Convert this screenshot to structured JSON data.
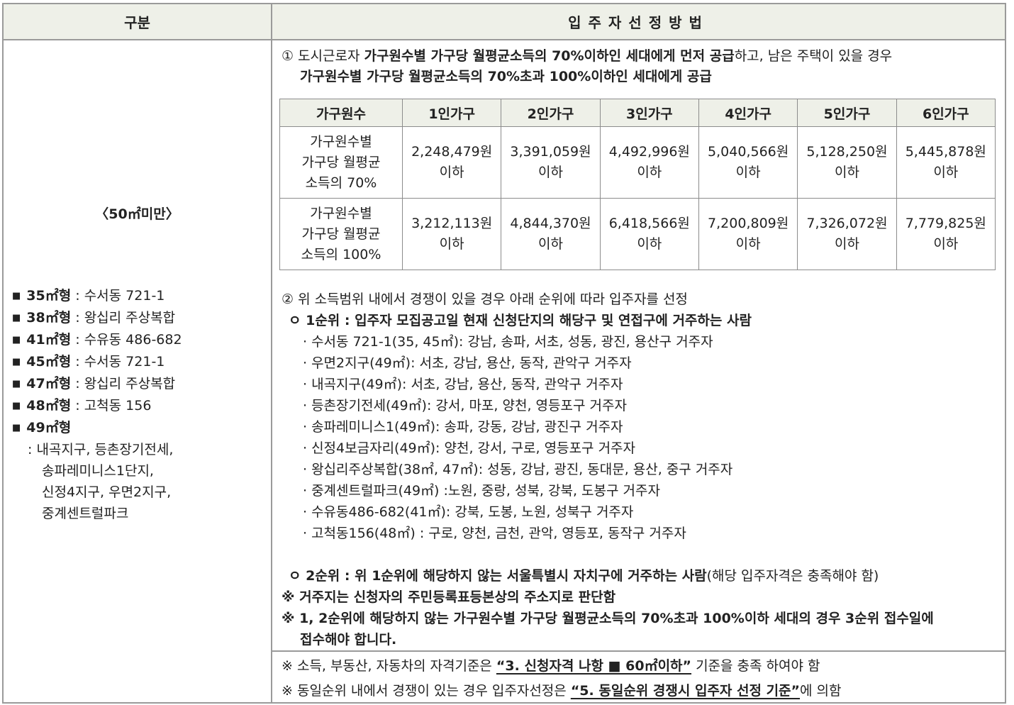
{
  "header": {
    "left": "구분",
    "right": "입주자선정방법"
  },
  "left": {
    "size_title": "〈50㎡미만〉",
    "sizes": [
      {
        "label": "35㎡형",
        "sep": " : ",
        "place": "수서동 721-1"
      },
      {
        "label": "38㎡형",
        "sep": " : ",
        "place": "왕십리 주상복합"
      },
      {
        "label": "41㎡형",
        "sep": " : ",
        "place": "수유동 486-682"
      },
      {
        "label": "45㎡형",
        "sep": " : ",
        "place": "수서동 721-1"
      },
      {
        "label": "47㎡형",
        "sep": " : ",
        "place": "왕십리 주상복합"
      },
      {
        "label": "48㎡형",
        "sep": " : ",
        "place": "고척동 156"
      }
    ],
    "last_label": "49㎡형",
    "last_lines": [
      ": 내곡지구, 등촌장기전세,",
      "송파레미니스1단지,",
      "신정4지구, 우면2지구,",
      "중계센트럴파크"
    ]
  },
  "lead": {
    "line1_a": "① 도시근로자 ",
    "line1_b": "가구원수별 가구당 월평균소득의 70%이하인 세대에게 먼저 공급",
    "line1_c": "하고, 남은 주택이 있을 경우",
    "line2": "가구원수별 가구당 월평균소득의 70%초과 100%이하인 세대에게 공급"
  },
  "income_table": {
    "headers": [
      "가구원수",
      "1인가구",
      "2인가구",
      "3인가구",
      "4인가구",
      "5인가구",
      "6인가구"
    ],
    "rows": [
      {
        "head": [
          "가구원수별",
          "가구당 월평균",
          "소득의 70%"
        ],
        "values": [
          "2,248,479원",
          "3,391,059원",
          "4,492,996원",
          "5,040,566원",
          "5,128,250원",
          "5,445,878원"
        ]
      },
      {
        "head": [
          "가구원수별",
          "가구당 월평균",
          "소득의 100%"
        ],
        "values": [
          "3,212,113원",
          "4,844,370원",
          "6,418,566원",
          "7,200,809원",
          "7,326,072원",
          "7,779,825원"
        ]
      }
    ],
    "suffix": "이하"
  },
  "section2": {
    "title": "② 위 소득범위 내에서 경쟁이 있을 경우 아래 순위에 따라 입주자를 선정",
    "rank1": "ㅇ 1순위 : 입주자 모집공고일 현재 신청단지의 해당구 및 연접구에 거주하는 사람",
    "items": [
      "· 수서동 721-1(35, 45㎡): 강남, 송파, 서초, 성동, 광진, 용산구 거주자",
      "· 우면2지구(49㎡): 서초, 강남, 용산, 동작, 관악구 거주자",
      "· 내곡지구(49㎡): 서초, 강남, 용산, 동작, 관악구 거주자",
      "· 등촌장기전세(49㎡): 강서, 마포, 양천, 영등포구 거주자",
      "· 송파레미니스1(49㎡): 송파, 강동, 강남, 광진구 거주자",
      "· 신정4보금자리(49㎡): 양천, 강서, 구로, 영등포구 거주자",
      "· 왕십리주상복합(38㎡, 47㎡): 성동, 강남, 광진, 동대문, 용산, 중구 거주자",
      "· 중계센트럴파크(49㎡) :노원, 중랑, 성북, 강북, 도봉구 거주자",
      "· 수유동486-682(41㎡): 강북, 도봉, 노원, 성북구 거주자",
      "· 고척동156(48㎡) : 구로, 양천, 금천, 관악, 영등포, 동작구 거주자"
    ],
    "rank2_bold": "ㅇ 2순위 : 위 1순위에 해당하지 않는 서울특별시 자치구에 거주하는 사람",
    "rank2_rest": "(해당 입주자격은 충족해야 함)",
    "note1": "※ 거주지는 신청자의 주민등록표등본상의 주소지로 판단함",
    "note2_a": "※ 1, 2순위에 해당하지 않는 가구원수별 가구당 월평균소득의 70%초과 100%이하 세대의 경우 3순위 접수일에",
    "note2_b": "접수해야 합니다."
  },
  "footer": {
    "fn1_a": "※ 소득, 부동산, 자동차의 자격기준은 ",
    "fn1_u": "“3. 신청자격 나항 ■ 60㎡이하”",
    "fn1_c": " 기준을 충족 하여야 함",
    "fn2_a": "※ 동일순위 내에서 경쟁이 있는 경우 입주자선정은 ",
    "fn2_u": "“5. 동일순위 경쟁시 입주자 선정 기준”",
    "fn2_c": "에 의함"
  }
}
